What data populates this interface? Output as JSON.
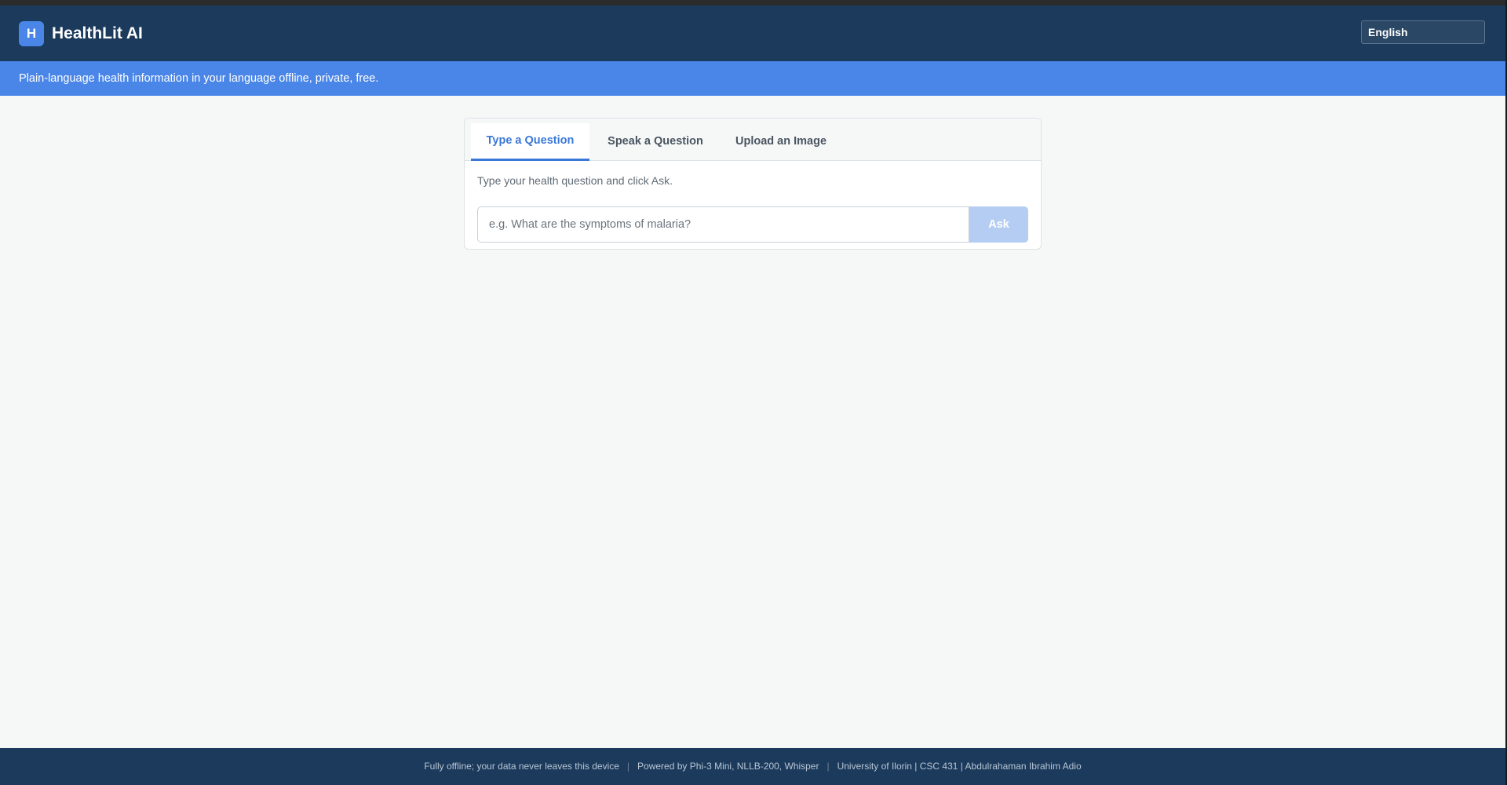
{
  "header": {
    "logo_letter": "H",
    "app_title": "HealthLit AI",
    "language_selected": "English"
  },
  "banner": {
    "text": "Plain-language health information in your language offline, private, free."
  },
  "tabs": [
    {
      "label": "Type a Question",
      "active": true
    },
    {
      "label": "Speak a Question",
      "active": false
    },
    {
      "label": "Upload an Image",
      "active": false
    }
  ],
  "ask_panel": {
    "hint": "Type your health question and click Ask.",
    "input_placeholder": "e.g. What are the symptoms of malaria?",
    "input_value": "",
    "ask_label": "Ask"
  },
  "footer": {
    "items": [
      "Fully offline; your data never leaves this device",
      "Powered by Phi-3 Mini, NLLB-200, Whisper",
      "University of Ilorin | CSC 431 | Abdulrahaman Ibrahim Adio"
    ],
    "separator": "|"
  },
  "colors": {
    "header_bg": "#1b3a5c",
    "accent": "#4a86e8",
    "active_tab": "#3a78d8",
    "ask_disabled": "#b5cdf2",
    "page_bg": "#f6f8f8"
  }
}
